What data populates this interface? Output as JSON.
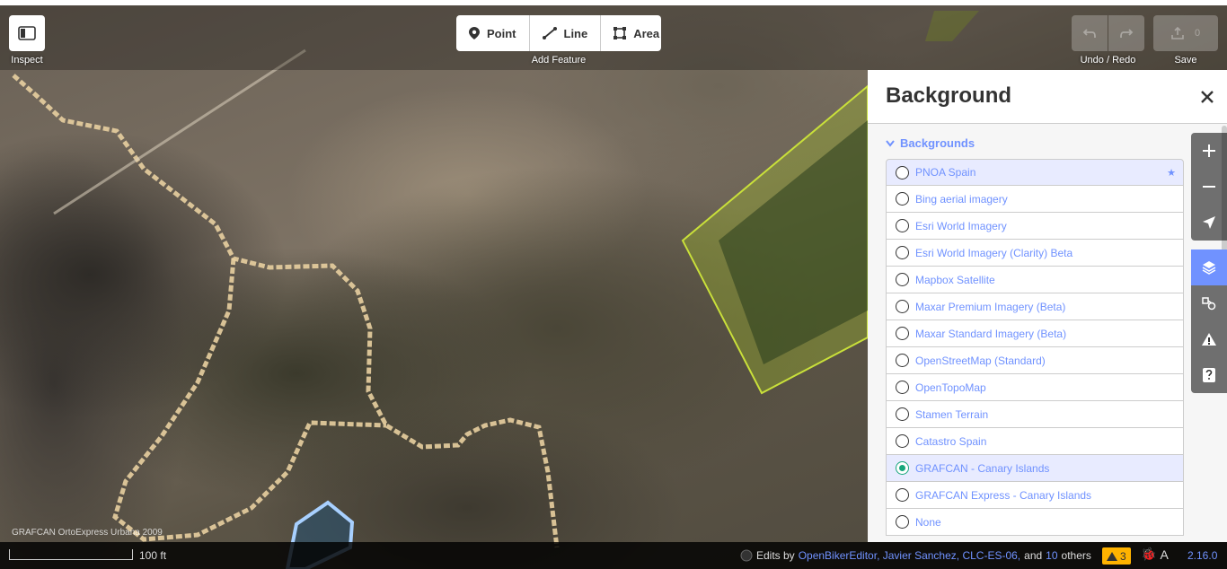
{
  "toolbar": {
    "inspect_label": "Inspect",
    "add_feature_label": "Add Feature",
    "point_label": "Point",
    "line_label": "Line",
    "area_label": "Area",
    "undo_redo_label": "Undo / Redo",
    "save_label": "Save",
    "save_count": "0"
  },
  "map": {
    "imagery_attribution": "GRAFCAN OrtoExpress Urbana 2009"
  },
  "panel": {
    "title": "Background",
    "section_title": "Backgrounds",
    "items": [
      {
        "label": "PNOA Spain",
        "selected": false,
        "highlighted": true,
        "favorite": true
      },
      {
        "label": "Bing aerial imagery",
        "selected": false
      },
      {
        "label": "Esri World Imagery",
        "selected": false
      },
      {
        "label": "Esri World Imagery (Clarity) Beta",
        "selected": false
      },
      {
        "label": "Mapbox Satellite",
        "selected": false
      },
      {
        "label": "Maxar Premium Imagery (Beta)",
        "selected": false
      },
      {
        "label": "Maxar Standard Imagery (Beta)",
        "selected": false
      },
      {
        "label": "OpenStreetMap (Standard)",
        "selected": false
      },
      {
        "label": "OpenTopoMap",
        "selected": false
      },
      {
        "label": "Stamen Terrain",
        "selected": false
      },
      {
        "label": "Catastro Spain",
        "selected": false
      },
      {
        "label": "GRAFCAN - Canary Islands",
        "selected": true
      },
      {
        "label": "GRAFCAN Express - Canary Islands",
        "selected": false
      },
      {
        "label": "None",
        "selected": false
      }
    ]
  },
  "footer": {
    "scale_label": "100 ft",
    "edits_prefix": "Edits by",
    "editors": "OpenBikerEditor, Javier Sanchez, CLC-ES-06,",
    "and_word": "and",
    "others_count": "10",
    "others_word": "others",
    "warnings_count": "3",
    "version": "2.16.0"
  },
  "colors": {
    "accent": "#7092ff",
    "selected_radio": "#16a67b",
    "warning": "#ffb300",
    "path_line": "#e8cfa0",
    "farm_outline": "#c9e03a"
  }
}
